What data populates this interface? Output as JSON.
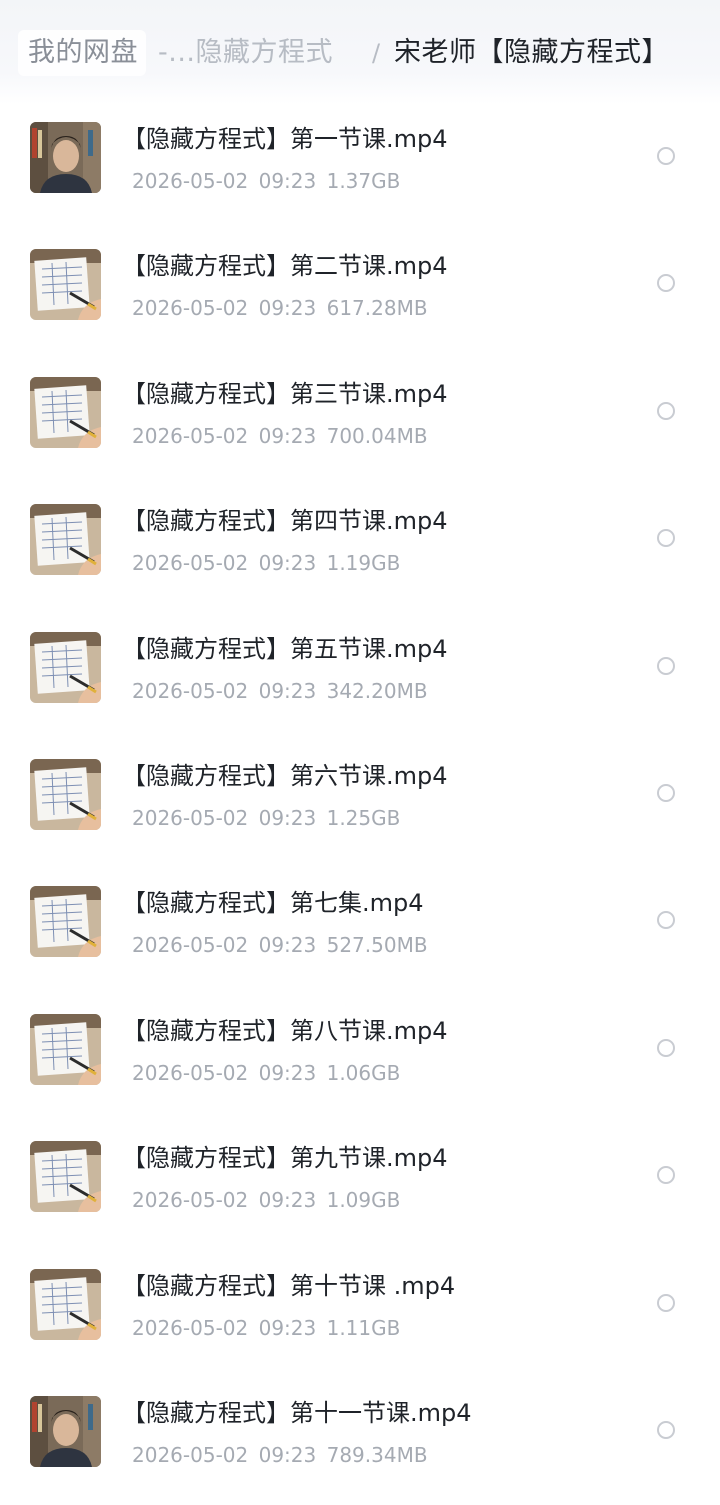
{
  "breadcrumb": {
    "root": "我的网盘",
    "middle": "-...隐藏方程式",
    "separator": "/",
    "current": "宋老师【隐藏方程式】"
  },
  "files": [
    {
      "name": "【隐藏方程式】第一节课.mp4",
      "date": "2026-05-02",
      "time": "09:23",
      "size": "1.37GB",
      "thumb": "person-video-icon"
    },
    {
      "name": "【隐藏方程式】第二节课.mp4",
      "date": "2026-05-02",
      "time": "09:23",
      "size": "617.28MB",
      "thumb": "worksheet-video-icon"
    },
    {
      "name": "【隐藏方程式】第三节课.mp4",
      "date": "2026-05-02",
      "time": "09:23",
      "size": "700.04MB",
      "thumb": "worksheet-video-icon"
    },
    {
      "name": "【隐藏方程式】第四节课.mp4",
      "date": "2026-05-02",
      "time": "09:23",
      "size": "1.19GB",
      "thumb": "worksheet-video-icon"
    },
    {
      "name": "【隐藏方程式】第五节课.mp4",
      "date": "2026-05-02",
      "time": "09:23",
      "size": "342.20MB",
      "thumb": "worksheet-video-icon"
    },
    {
      "name": "【隐藏方程式】第六节课.mp4",
      "date": "2026-05-02",
      "time": "09:23",
      "size": "1.25GB",
      "thumb": "worksheet-video-icon"
    },
    {
      "name": "【隐藏方程式】第七集.mp4",
      "date": "2026-05-02",
      "time": "09:23",
      "size": "527.50MB",
      "thumb": "worksheet-video-icon"
    },
    {
      "name": "【隐藏方程式】第八节课.mp4",
      "date": "2026-05-02",
      "time": "09:23",
      "size": "1.06GB",
      "thumb": "worksheet-video-icon"
    },
    {
      "name": "【隐藏方程式】第九节课.mp4",
      "date": "2026-05-02",
      "time": "09:23",
      "size": "1.09GB",
      "thumb": "worksheet-video-icon"
    },
    {
      "name": "【隐藏方程式】第十节课 .mp4",
      "date": "2026-05-02",
      "time": "09:23",
      "size": "1.11GB",
      "thumb": "worksheet-video-icon"
    },
    {
      "name": "【隐藏方程式】第十一节课.mp4",
      "date": "2026-05-02",
      "time": "09:23",
      "size": "789.34MB",
      "thumb": "person-video-icon"
    }
  ]
}
